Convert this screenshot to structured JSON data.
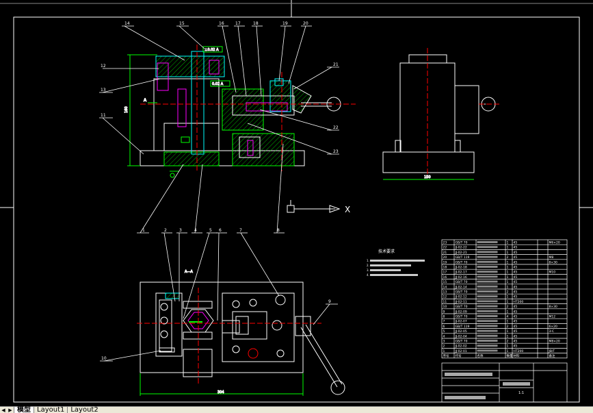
{
  "drawing": {
    "callouts_top": [
      "14",
      "15",
      "16",
      "17",
      "18",
      "19",
      "20",
      "21",
      "12",
      "13",
      "11",
      "22",
      "23"
    ],
    "callouts_bottom": [
      "1",
      "2",
      "3",
      "4",
      "5",
      "6",
      "7",
      "8",
      "9",
      "10"
    ],
    "tech_req_title": "技术要求",
    "tech_req_lines": [
      "1.",
      "2.",
      "3.",
      "4."
    ],
    "section_label": "A—A",
    "view_label": "A",
    "dimension_bottom": "304",
    "dimension_right": "150",
    "dimension_height": "160",
    "tolerance_top": "⊥0.02 A",
    "tolerance_mid": "0.02 A",
    "ucs_x": "X"
  },
  "bom_rows": [
    [
      "23",
      "GB/T 70",
      "",
      "1",
      "45",
      "",
      "M6×20"
    ],
    [
      "22",
      "JJ-02-22",
      "",
      "1",
      "45",
      "",
      ""
    ],
    [
      "21",
      "JJ-02-21",
      "",
      "1",
      "45",
      "",
      ""
    ],
    [
      "20",
      "GB/T 119",
      "",
      "2",
      "45",
      "",
      "M8"
    ],
    [
      "19",
      "GB/T 70",
      "",
      "1",
      "45",
      "",
      "8×30"
    ],
    [
      "18",
      "JJ-02-18",
      "",
      "1",
      "45",
      "",
      ""
    ],
    [
      "17",
      "JJ-02-17",
      "",
      "1",
      "45",
      "",
      "M10"
    ],
    [
      "16",
      "JJ-02-16",
      "",
      "1",
      "45",
      "",
      ""
    ],
    [
      "15",
      "GB/T 70",
      "",
      "1",
      "45",
      "",
      ""
    ],
    [
      "14",
      "JJ-02-14",
      "",
      "1",
      "45",
      "",
      ""
    ],
    [
      "13",
      "GB/T 70",
      "",
      "2",
      "45",
      "",
      ""
    ],
    [
      "12",
      "JJ-02-12",
      "",
      "1",
      "45",
      "",
      ""
    ],
    [
      "11",
      "JJ-02-11",
      "",
      "1",
      "HT200",
      "",
      ""
    ],
    [
      "10",
      "GB/T 70",
      "",
      "2",
      "45",
      "",
      "8×30"
    ],
    [
      "9",
      "JJ-02-09",
      "",
      "1",
      "45",
      "",
      ""
    ],
    [
      "8",
      "GB/T 70",
      "",
      "4",
      "45",
      "",
      "M12"
    ],
    [
      "7",
      "JJ-02-07",
      "",
      "1",
      "45",
      "",
      ""
    ],
    [
      "6",
      "GB/T 119",
      "",
      "2",
      "45",
      "",
      "6×20"
    ],
    [
      "5",
      "JJ-02-05",
      "",
      "1",
      "45",
      "",
      "3-C"
    ],
    [
      "4",
      "JJ-02-04",
      "",
      "1",
      "45",
      "",
      ""
    ],
    [
      "3",
      "GB/T 70",
      "",
      "2",
      "45",
      "",
      "M8×20"
    ],
    [
      "2",
      "JJ-02-02",
      "",
      "1",
      "45",
      "",
      ""
    ],
    [
      "1",
      "JJ-02-01",
      "",
      "1",
      "HT200",
      "",
      "JB/T"
    ]
  ],
  "bom_header": [
    "序号",
    "代号",
    "名称",
    "数量",
    "材料",
    "",
    "备注"
  ],
  "title_block": {
    "scale": "1:1"
  },
  "layout_tabs": {
    "model": "模型",
    "layout1": "Layout1",
    "layout2": "Layout2"
  }
}
